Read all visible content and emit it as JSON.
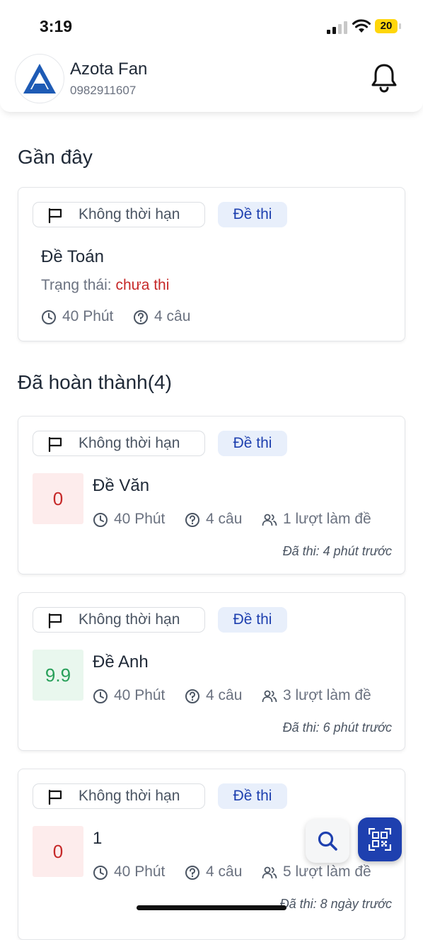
{
  "status_bar": {
    "time": "3:19",
    "battery": "20"
  },
  "header": {
    "name": "Azota Fan",
    "phone": "0982911607"
  },
  "recent": {
    "title": "Gần đây",
    "card": {
      "time_tag": "Không thời hạn",
      "type_tag": "Đề thi",
      "title": "Đề Toán",
      "status_label": "Trạng thái: ",
      "status_value": "chưa thi",
      "duration": "40 Phút",
      "questions": "4 câu"
    }
  },
  "completed": {
    "title": "Đã hoàn thành(4)",
    "cards": [
      {
        "time_tag": "Không thời hạn",
        "type_tag": "Đề thi",
        "score": "0",
        "title": "Đề Văn",
        "duration": "40 Phút",
        "questions": "4 câu",
        "attempts": "1 lượt làm đề",
        "done": "Đã thi: 4 phút trước"
      },
      {
        "time_tag": "Không thời hạn",
        "type_tag": "Đề thi",
        "score": "9.9",
        "title": "Đề Anh",
        "duration": "40 Phút",
        "questions": "4 câu",
        "attempts": "3 lượt làm đề",
        "done": "Đã thi: 6 phút trước"
      },
      {
        "time_tag": "Không thời hạn",
        "type_tag": "Đề thi",
        "score": "0",
        "title": "1",
        "duration": "40 Phút",
        "questions": "4 câu",
        "attempts": "5 lượt làm đề",
        "done": "Đã thi: 8 ngày trước"
      }
    ]
  },
  "colors": {
    "accent": "#1e40af",
    "status_pending": "#c62828",
    "score_low": "#c62828",
    "score_high": "#28a05a"
  }
}
